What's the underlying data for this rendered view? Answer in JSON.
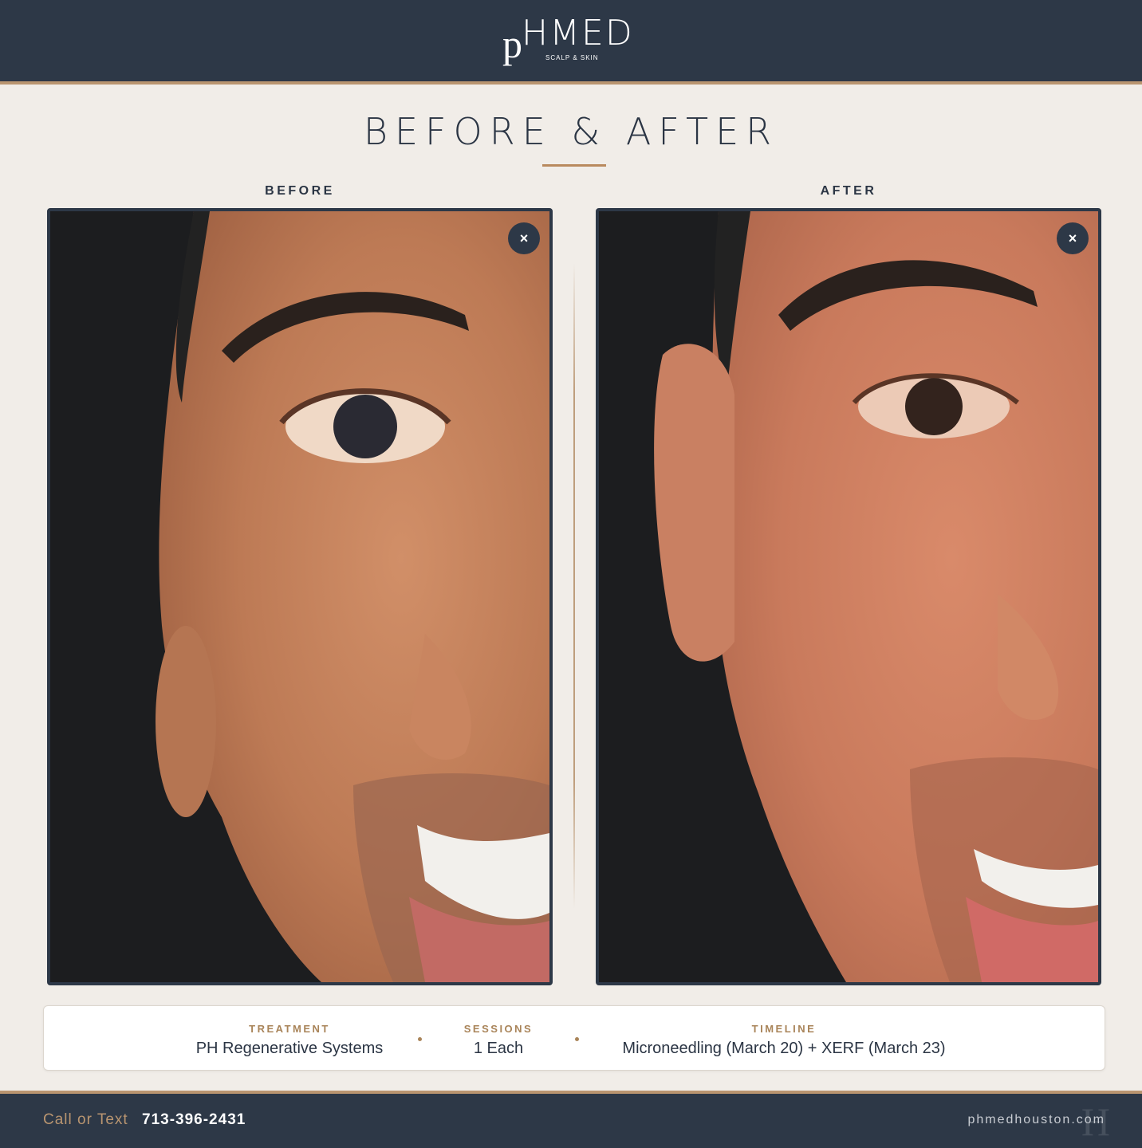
{
  "brand": {
    "logo_p": "p",
    "logo_main": "HMED",
    "logo_sub": "SCALP & SKIN"
  },
  "page": {
    "title": "BEFORE & AFTER"
  },
  "before": {
    "label": "BEFORE",
    "close": "×"
  },
  "after": {
    "label": "AFTER",
    "close": "×"
  },
  "info": {
    "treatment_label": "TREATMENT",
    "treatment_value": "PH Regenerative Systems",
    "sessions_label": "SESSIONS",
    "sessions_value": "1 Each",
    "timeline_label": "TIMELINE",
    "timeline_value": "Microneedling (March 20) + XERF (March 23)"
  },
  "footer": {
    "call_label": "Call or Text",
    "phone": "713-396-2431",
    "website": "phmedhouston.com"
  },
  "colors": {
    "navy": "#2d3847",
    "gold": "#b99570",
    "background": "#f1ede8"
  }
}
